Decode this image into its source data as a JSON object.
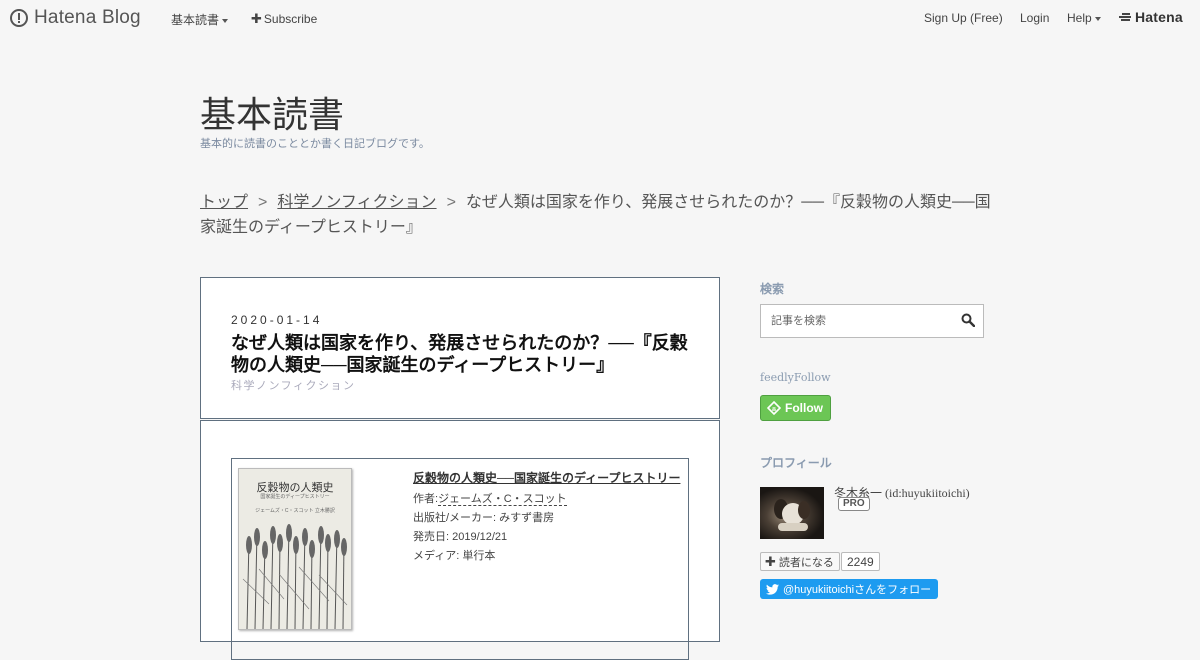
{
  "globalbar": {
    "logo": "Hatena Blog",
    "menu_label": "基本読書",
    "subscribe": "Subscribe",
    "signup": "Sign Up (Free)",
    "login": "Login",
    "help": "Help",
    "hatena_logo": "Hatena"
  },
  "blog": {
    "title": "基本読書",
    "description": "基本的に読書のこととか書く日記ブログです。"
  },
  "breadcrumb": {
    "items": [
      "トップ",
      "科学ノンフィクション"
    ],
    "separator": ">",
    "current": "なぜ人類は国家を作り、発展させられたのか？──『反穀物の人類史──国家誕生のディープヒストリー』"
  },
  "article": {
    "date": "2020-01-14",
    "title": "なぜ人類は国家を作り、発展させられたのか？──『反穀物の人類史──国家誕生のディープヒストリー』",
    "category": "科学ノンフィクション",
    "book": {
      "title": "反穀物の人類史──国家誕生のディープヒストリー",
      "author_label": "作者:",
      "author": "ジェームズ・C・スコット",
      "publisher": "出版社/メーカー: みすず書房",
      "release": "発売日: 2019/12/21",
      "media": "メディア: 単行本",
      "cover_title": "反穀物の人類史",
      "cover_subtitle": "国家誕生のディープヒストリー",
      "cover_author": "ジェームズ・C・スコット  立木勝訳"
    }
  },
  "sidebar": {
    "search_label": "検索",
    "search_placeholder": "記事を検索",
    "feedly_label": "feedlyFollow",
    "feedly_button": "Follow",
    "profile_label": "プロフィール",
    "profile_name": "冬木糸一 (id:huyukiitoichi)",
    "pro_badge": "PRO",
    "reader_button": "読者になる",
    "reader_count": "2249",
    "twitter_button": "@huyukiitoichiさんをフォロー"
  },
  "colors": {
    "background": "#f6f6f6",
    "feedly": "#6cc655",
    "twitter": "#1d9bf0",
    "border": "#607080"
  }
}
